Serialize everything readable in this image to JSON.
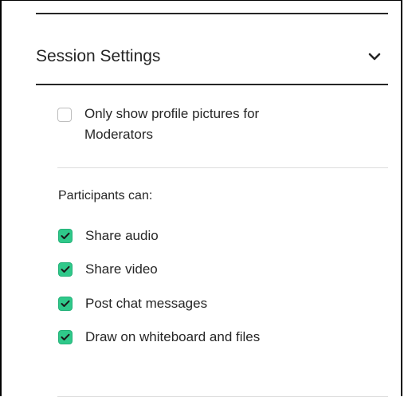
{
  "session_settings": {
    "title": "Session Settings",
    "expanded_icon": "chevron-down-icon"
  },
  "profile_option": {
    "label_line1": "Only show profile pictures for",
    "label_line2": "Moderators",
    "checked": false
  },
  "participants": {
    "heading": "Participants can:",
    "permissions": [
      {
        "label": "Share audio",
        "checked": true
      },
      {
        "label": "Share video",
        "checked": true
      },
      {
        "label": "Post chat messages",
        "checked": true
      },
      {
        "label": "Draw on whiteboard and files",
        "checked": true
      }
    ]
  },
  "colors": {
    "checkbox_checked": "#2fc98a",
    "text": "#262626"
  }
}
